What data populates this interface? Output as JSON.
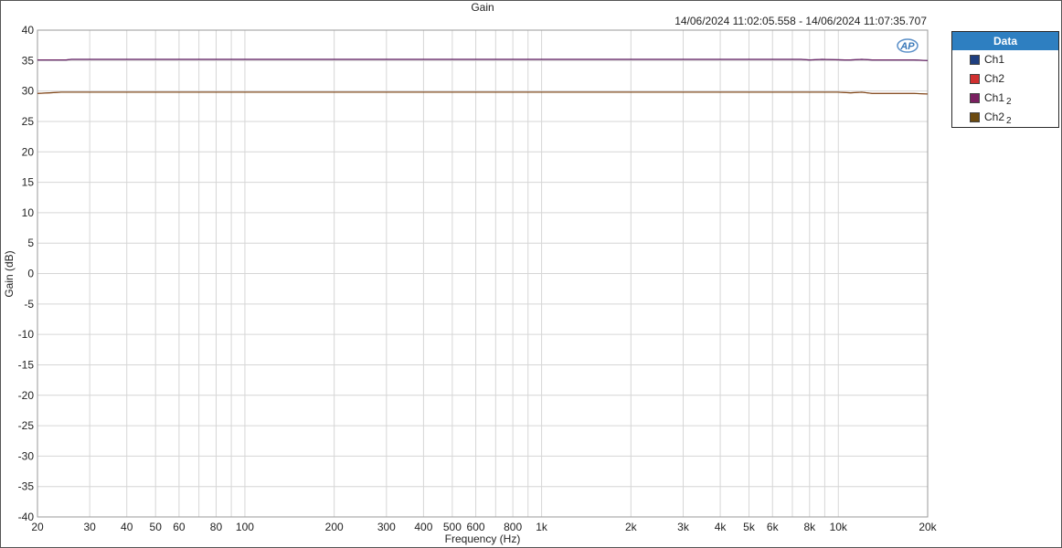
{
  "chart_data": {
    "type": "line",
    "title": "Gain",
    "subtitle": "14/06/2024 11:02:05.558 - 14/06/2024 11:07:35.707",
    "xlabel": "Frequency (Hz)",
    "ylabel": "Gain (dB)",
    "xscale": "log",
    "xlim": [
      20,
      20000
    ],
    "ylim": [
      -40,
      40
    ],
    "yticks": [
      40,
      35,
      30,
      25,
      20,
      15,
      10,
      5,
      0,
      -5,
      -10,
      -15,
      -20,
      -25,
      -30,
      -35,
      -40
    ],
    "xtick_values": [
      20,
      30,
      40,
      50,
      60,
      80,
      100,
      200,
      300,
      400,
      500,
      600,
      800,
      1000,
      2000,
      3000,
      4000,
      5000,
      6000,
      8000,
      10000,
      20000
    ],
    "xtick_labels": [
      "20",
      "30",
      "40",
      "50",
      "60",
      "80",
      "100",
      "200",
      "300",
      "400",
      "500",
      "600",
      "800",
      "1k",
      "2k",
      "3k",
      "4k",
      "5k",
      "6k",
      "8k",
      "10k",
      "20k"
    ],
    "grid": true,
    "legend_position": "right",
    "legend_title": "Data",
    "series": [
      {
        "name": "Ch1",
        "sub": "",
        "color": "#1f3f7f",
        "x": [
          20,
          25,
          26,
          50,
          100,
          1000,
          5000,
          7500,
          8000,
          8800,
          10500,
          11000,
          12000,
          13000,
          18000,
          20000
        ],
        "y": [
          35.1,
          35.1,
          35.2,
          35.2,
          35.2,
          35.2,
          35.2,
          35.2,
          35.1,
          35.2,
          35.1,
          35.1,
          35.2,
          35.1,
          35.1,
          35.0
        ]
      },
      {
        "name": "Ch2",
        "sub": "",
        "color": "#d03030",
        "x": [
          20,
          22,
          24,
          50,
          100,
          1000,
          5000,
          10000,
          11000,
          12000,
          13000,
          18000,
          20000
        ],
        "y": [
          29.6,
          29.7,
          29.8,
          29.8,
          29.8,
          29.8,
          29.8,
          29.8,
          29.7,
          29.8,
          29.6,
          29.6,
          29.5
        ]
      },
      {
        "name": "Ch1",
        "sub": "2",
        "color": "#7a2060",
        "x": [
          20,
          25,
          26,
          50,
          100,
          1000,
          5000,
          7500,
          8000,
          8800,
          10500,
          11000,
          12000,
          13000,
          18000,
          20000
        ],
        "y": [
          35.1,
          35.1,
          35.2,
          35.2,
          35.2,
          35.2,
          35.2,
          35.2,
          35.1,
          35.2,
          35.1,
          35.1,
          35.2,
          35.1,
          35.1,
          35.0
        ]
      },
      {
        "name": "Ch2",
        "sub": "2",
        "color": "#6b4a10",
        "x": [
          20,
          22,
          24,
          50,
          100,
          1000,
          5000,
          10000,
          11000,
          12000,
          13000,
          18000,
          20000
        ],
        "y": [
          29.6,
          29.7,
          29.8,
          29.8,
          29.8,
          29.8,
          29.8,
          29.8,
          29.7,
          29.8,
          29.6,
          29.6,
          29.5
        ]
      }
    ]
  },
  "logo_text": "AP"
}
